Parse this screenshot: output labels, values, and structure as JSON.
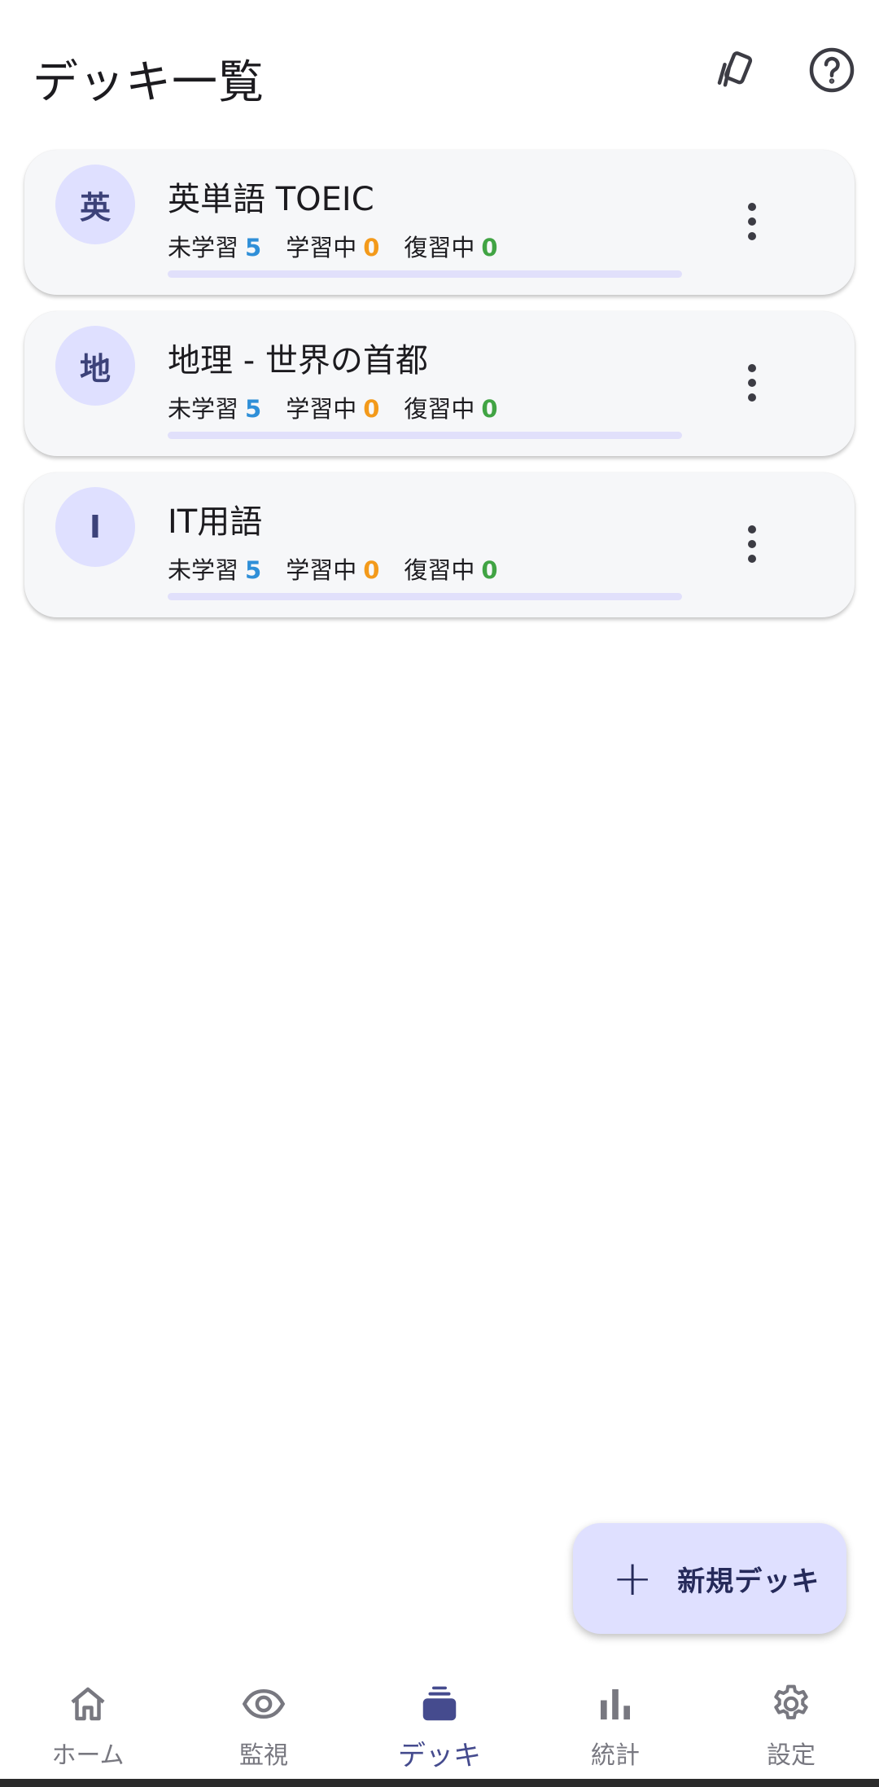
{
  "app_bar": {
    "title": "デッキ一覧",
    "actions": [
      {
        "icon": "cards-icon"
      },
      {
        "icon": "help-icon"
      }
    ]
  },
  "decks": [
    {
      "avatar": "英",
      "name": "英単語 TOEIC",
      "stats": [
        {
          "label": "未学習",
          "value": "5"
        },
        {
          "label": "学習中",
          "value": "0"
        },
        {
          "label": "復習中",
          "value": "0"
        }
      ],
      "progress": 0
    },
    {
      "avatar": "地",
      "name": "地理 - 世界の首都",
      "stats": [
        {
          "label": "未学習",
          "value": "5"
        },
        {
          "label": "学習中",
          "value": "0"
        },
        {
          "label": "復習中",
          "value": "0"
        }
      ],
      "progress": 0
    },
    {
      "avatar": "I",
      "name": "IT用語",
      "stats": [
        {
          "label": "未学習",
          "value": "5"
        },
        {
          "label": "学習中",
          "value": "0"
        },
        {
          "label": "復習中",
          "value": "0"
        }
      ],
      "progress": 0
    }
  ],
  "fab": {
    "icon": "plus-icon",
    "label": "新規デッキ"
  },
  "bottom_nav": {
    "items": [
      {
        "icon": "home-icon",
        "label": "ホーム",
        "active": false
      },
      {
        "icon": "eye-icon",
        "label": "監視",
        "active": false
      },
      {
        "icon": "deck-stack-icon",
        "label": "デッキ",
        "active": true
      },
      {
        "icon": "bar-chart-icon",
        "label": "統計",
        "active": false
      },
      {
        "icon": "gear-icon",
        "label": "設定",
        "active": false
      }
    ]
  },
  "colors": {
    "accent": "#454b8e",
    "avatar_bg": "#dfe0ff",
    "new": "#2f8fd8",
    "learning": "#f39a1b",
    "review": "#41a444"
  }
}
